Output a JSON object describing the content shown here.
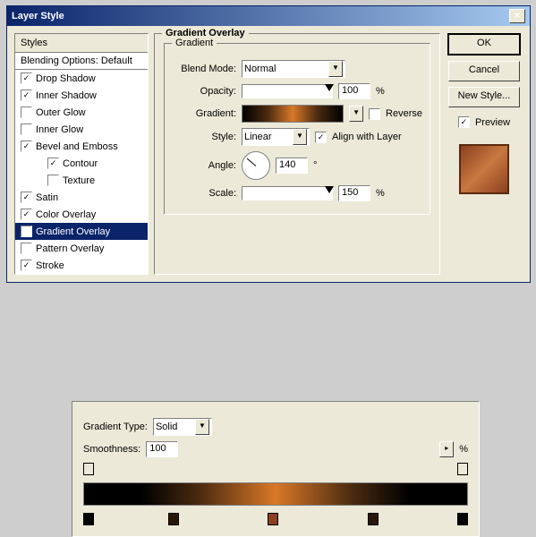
{
  "dialog": {
    "title": "Layer Style",
    "styles_header": "Styles",
    "blending_opts": "Blending Options: Default",
    "items": [
      {
        "label": "Drop Shadow",
        "checked": true
      },
      {
        "label": "Inner Shadow",
        "checked": true
      },
      {
        "label": "Outer Glow",
        "checked": false
      },
      {
        "label": "Inner Glow",
        "checked": false
      },
      {
        "label": "Bevel and Emboss",
        "checked": true
      },
      {
        "label": "Contour",
        "checked": true,
        "indent": true
      },
      {
        "label": "Texture",
        "checked": false,
        "indent": true
      },
      {
        "label": "Satin",
        "checked": true
      },
      {
        "label": "Color Overlay",
        "checked": true
      },
      {
        "label": "Gradient Overlay",
        "checked": true,
        "selected": true
      },
      {
        "label": "Pattern Overlay",
        "checked": false
      },
      {
        "label": "Stroke",
        "checked": true
      }
    ]
  },
  "panel": {
    "title": "Gradient Overlay",
    "subtitle": "Gradient",
    "blend_mode_label": "Blend Mode:",
    "blend_mode": "Normal",
    "opacity_label": "Opacity:",
    "opacity": "100",
    "pct": "%",
    "gradient_label": "Gradient:",
    "reverse_label": "Reverse",
    "style_label": "Style:",
    "style": "Linear",
    "align_label": "Align with Layer",
    "angle_label": "Angle:",
    "angle": "140",
    "deg": "°",
    "scale_label": "Scale:",
    "scale": "150"
  },
  "buttons": {
    "ok": "OK",
    "cancel": "Cancel",
    "new_style": "New Style...",
    "preview": "Preview"
  },
  "editor": {
    "type_label": "Gradient Type:",
    "type": "Solid",
    "smooth_label": "Smoothness:",
    "smooth": "100",
    "pct": "%"
  }
}
